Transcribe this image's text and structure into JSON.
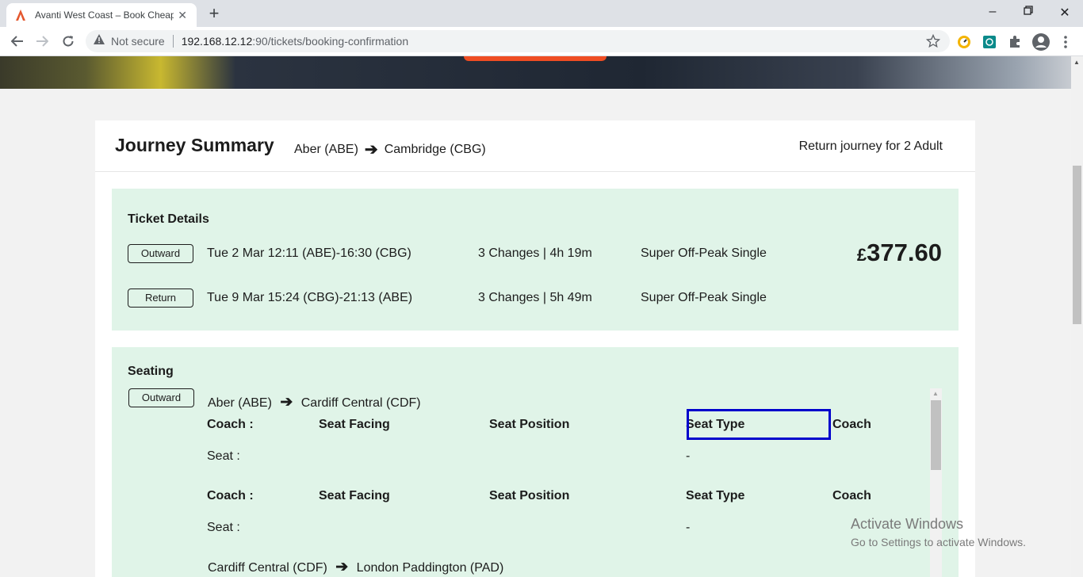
{
  "browser": {
    "tab_title": "Avanti West Coast – Book Cheap",
    "security_label": "Not secure",
    "url_host": "192.168.12.12",
    "url_path": ":90/tickets/booking-confirmation"
  },
  "summary": {
    "title": "Journey Summary",
    "origin": "Aber (ABE)",
    "destination": "Cambridge (CBG)",
    "passengers": "Return journey for 2 Adult"
  },
  "tickets": {
    "heading": "Ticket Details",
    "price_symbol": "£",
    "price": "377.60",
    "rows": [
      {
        "badge": "Outward",
        "times": "Tue 2 Mar 12:11 (ABE)-16:30 (CBG)",
        "changes": "3 Changes | 4h 19m",
        "fare": "Super Off-Peak Single"
      },
      {
        "badge": "Return",
        "times": "Tue 9 Mar 15:24 (CBG)-21:13 (ABE)",
        "changes": "3 Changes | 5h 49m",
        "fare": "Super Off-Peak Single"
      }
    ]
  },
  "seating": {
    "heading": "Seating",
    "badge": "Outward",
    "leg1": {
      "from": "Aber (ABE)",
      "to": "Cardiff Central (CDF)"
    },
    "leg2": {
      "from": "Cardiff Central (CDF)",
      "to": "London Paddington (PAD)"
    },
    "columns": {
      "coach": "Coach :",
      "facing": "Seat Facing",
      "position": "Seat Position",
      "type": "Seat Type",
      "coach2": "Coach"
    },
    "seat_label": "Seat :",
    "seat_value": "-"
  },
  "watermark": {
    "line1": "Activate Windows",
    "line2": "Go to Settings to activate Windows."
  }
}
